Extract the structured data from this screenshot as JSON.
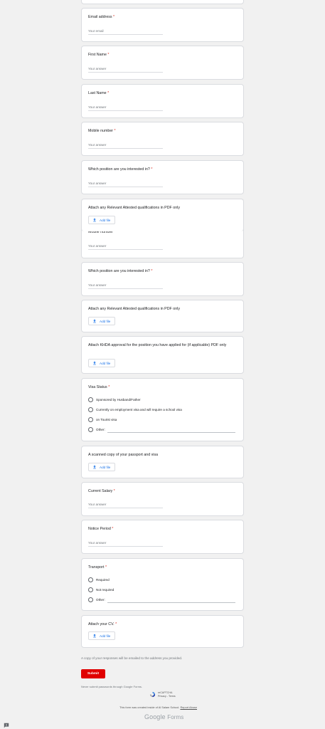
{
  "questions": {
    "email": {
      "title": "Email address",
      "placeholder": "Your email"
    },
    "first_name": {
      "title": "First Name",
      "placeholder": "Your answer"
    },
    "last_name": {
      "title": "Last Name",
      "placeholder": "Your answer"
    },
    "mobile1": {
      "title": "Mobile number",
      "placeholder": "Your answer"
    },
    "position1": {
      "title": "Which position are you interested in?",
      "placeholder": "Your answer"
    },
    "attach_qual1": {
      "title": "Attach any Relevant Attested qualifications in PDF only",
      "button": "Add file"
    },
    "mobile2": {
      "title": "Mobile number",
      "placeholder": "Your answer"
    },
    "position2": {
      "title": "Which position are you interested in?",
      "placeholder": "Your answer"
    },
    "attach_qual2": {
      "title": "Attach any Relevant Attested qualifications in PDF only",
      "button": "Add file"
    },
    "khda": {
      "title": "Attach KHDA approval for the position you have applied for (if applicable) PDF only",
      "button": "Add file"
    },
    "visa": {
      "title": "Visa Status",
      "options": [
        "Sponsored by Husband/Father",
        "Currently on employment visa and will require a school visa",
        "on Tourist visa",
        "Other:"
      ]
    },
    "passport": {
      "title": "A scanned copy of your passport and visa",
      "button": "Add file"
    },
    "salary": {
      "title": "Current Salary",
      "placeholder": "Your answer"
    },
    "notice": {
      "title": "Notice Period",
      "placeholder": "Your answer"
    },
    "transport": {
      "title": "Transport",
      "options": [
        "Required",
        "Not required",
        "Other:"
      ]
    },
    "cv": {
      "title": "Attach your CV.",
      "button": "Add file"
    }
  },
  "required_mark": "*",
  "footer": {
    "copy_note": "A copy of your responses will be emailed to the address you provided.",
    "submit": "Submit",
    "never_submit": "Never submit passwords through Google Forms.",
    "recaptcha": "reCAPTCHA",
    "privacy": "Privacy",
    "terms": "Terms",
    "created_note": "This form was created inside of Al Salam School.",
    "report": "Report Abuse",
    "brand_google": "Google",
    "brand_forms": "Forms"
  },
  "colors": {
    "required": "#d93025",
    "submit": "#e00000",
    "link": "#1a73e8"
  }
}
